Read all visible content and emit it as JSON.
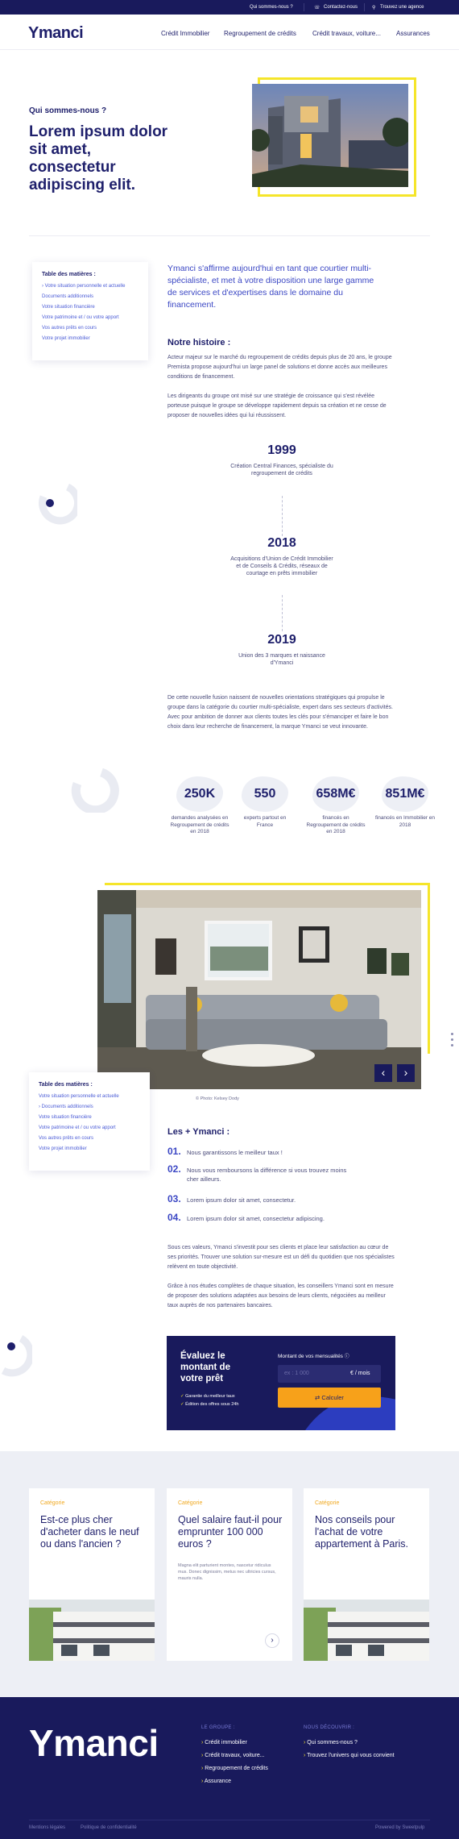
{
  "topbar": {
    "about": "Qui sommes-nous ?",
    "contact": "Contactez-nous",
    "agency": "Trouvez une agence"
  },
  "header": {
    "logo": "Ymanci",
    "nav": [
      "Crédit Immobilier",
      "Regroupement de crédits",
      "Crédit travaux, voiture...",
      "Assurances"
    ]
  },
  "hero": {
    "eyebrow": "Qui sommes-nous ?",
    "title": "Lorem ipsum dolor sit amet, consectetur adipiscing elit."
  },
  "toc": {
    "title": "Table des matières :",
    "items": [
      "Votre situation personnelle et actuelle",
      "Documents additionnels",
      "Votre situation financière",
      "Votre patrimoine et / ou votre apport",
      "Vos autres prêts en cours",
      "Votre projet immobilier"
    ]
  },
  "intro": {
    "lead": "Ymanci s'affirme aujourd'hui en tant que courtier multi-spécialiste, et met à votre disposition une large gamme de services et d'expertises dans le domaine du financement.",
    "history_title": "Notre histoire :",
    "p1": "Acteur majeur sur le marché du regroupement de crédits depuis plus de 20 ans, le groupe Premista propose aujourd'hui un large panel de solutions et donne accès aux meilleures conditions de financement.",
    "p2": "Les dirigeants du groupe ont misé sur une stratégie de croissance qui s'est révélée porteuse puisque le groupe se développe rapidement depuis sa création et ne cesse de proposer de nouvelles idées qui lui réussissent."
  },
  "timeline": [
    {
      "year": "1999",
      "desc": "Création Central Finances, spécialiste du regroupement de crédits"
    },
    {
      "year": "2018",
      "desc": "Acquisitions d'Union de Crédit Immobilier et de Conseils & Crédits, réseaux de courtage en prêts immobilier"
    },
    {
      "year": "2019",
      "desc": "Union des 3 marques et naissance d'Ymanci"
    }
  ],
  "fusion_text": "De cette nouvelle fusion naissent de nouvelles orientations stratégiques qui propulse le groupe dans la catégorie du courtier multi-spécialiste, expert dans ses secteurs d'activités. Avec pour ambition de donner aux clients toutes les clés pour s'émanciper et faire le bon choix dans leur recherche de financement, la marque Ymanci se veut innovante.",
  "stats": [
    {
      "value": "250K",
      "label": "demandes analysées en Regroupement de crédits en 2018"
    },
    {
      "value": "550",
      "label": "experts partout en France"
    },
    {
      "value": "658M€",
      "label": "financés en Regroupement de crédits en 2018"
    },
    {
      "value": "851M€",
      "label": "financés en Immobilier en 2018"
    }
  ],
  "gallery": {
    "caption": "© Photo: Kelsey Dody",
    "prev": "‹",
    "next": "›"
  },
  "plus": {
    "title": "Les + Ymanci :",
    "items": [
      {
        "n": "01.",
        "t": "Nous garantissons le meilleur taux !"
      },
      {
        "n": "02.",
        "t": "Nous vous remboursons la différence si vous trouvez moins cher ailleurs."
      },
      {
        "n": "03.",
        "t": "Lorem ipsum dolor sit amet, consectetur."
      },
      {
        "n": "04.",
        "t": "Lorem ipsum dolor sit amet, consectetur adipiscing."
      }
    ],
    "p1": "Sous ces valeurs, Ymanci s'investit pour ses clients et place leur satisfaction au cœur de ses priorités. Trouver une solution sur-mesure est un défi du quotidien que nos spécialistes relèvent en toute objectivité.",
    "p2": "Grâce à nos études complètes de chaque situation, les conseillers Ymanci sont en mesure de proposer des solutions adaptées aux besoins de leurs clients, négociées au meilleur taux auprès de nos partenaires bancaires."
  },
  "simulator": {
    "title": "Évaluez le montant de votre prêt",
    "check1": "Garantie du meilleur taux",
    "check2": "Édition des offres sous 24h",
    "field_label": "Montant de vos mensualités",
    "placeholder": "ex : 1 000",
    "unit": "€ / mois",
    "button": "Calculer"
  },
  "articles": [
    {
      "category": "Catégorie",
      "title": "Est-ce plus cher d'acheter dans le neuf ou dans l'ancien ?",
      "excerpt": ""
    },
    {
      "category": "Catégorie",
      "title": "Quel salaire faut-il pour emprunter 100 000 euros ?",
      "excerpt": "Magna elit parturient montes, nascetur ridiculus mus. Donec dignissim, metus nec ultricies cursus, mauris nulla."
    },
    {
      "category": "Catégorie",
      "title": "Nos conseils pour l'achat de votre appartement à Paris.",
      "excerpt": ""
    }
  ],
  "footer": {
    "logo": "Ymanci",
    "col1_title": "LE GROUPE :",
    "col1": [
      "Crédit immobilier",
      "Crédit travaux, voiture...",
      "Regroupement de crédits",
      "Assurance"
    ],
    "col2_title": "NOUS DÉCOUVRIR :",
    "col2": [
      "Qui sommes-nous ?",
      "Trouvez l'univers qui vous convient"
    ],
    "legal": "Mentions légales",
    "privacy": "Politique de confidentialité",
    "powered": "Powered by Sweetpulp"
  },
  "colors": {
    "navy": "#191a5c",
    "blue": "#3b47c4",
    "yellow": "#f5e52a",
    "orange": "#f7a11a"
  }
}
